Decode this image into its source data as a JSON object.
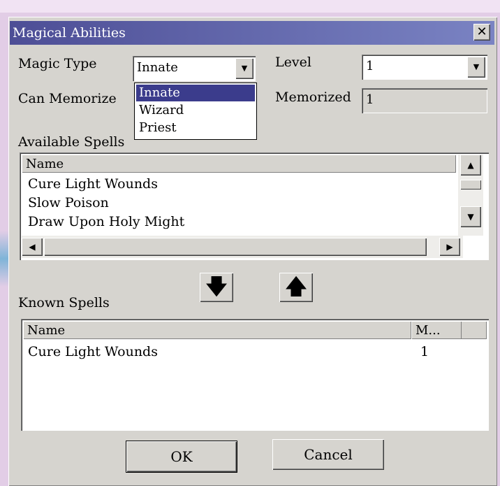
{
  "window": {
    "title": "Magical Abilities",
    "close_glyph": "✕"
  },
  "form": {
    "magic_type_label": "Magic Type",
    "magic_type_value": "Innate",
    "magic_type_options": [
      "Innate",
      "Wizard",
      "Priest"
    ],
    "magic_type_selected_index": 0,
    "level_label": "Level",
    "level_value": "1",
    "can_memorize_label": "Can Memorize",
    "memorized_label": "Memorized",
    "memorized_value": "1"
  },
  "available_spells": {
    "label": "Available Spells",
    "columns": [
      "Name"
    ],
    "rows": [
      "Cure Light Wounds",
      "Slow Poison",
      "Draw Upon Holy Might"
    ]
  },
  "transfer": {
    "down_icon": "down-arrow-icon",
    "down_glyph": "🡇",
    "up_icon": "up-arrow-icon",
    "up_glyph": "🡅"
  },
  "known_spells": {
    "label": "Known Spells",
    "columns": [
      "Name",
      "M..."
    ],
    "rows": [
      {
        "name": "Cure Light Wounds",
        "m": "1"
      }
    ]
  },
  "buttons": {
    "ok_label": "OK",
    "cancel_label": "Cancel"
  },
  "icons": {
    "combo_arrow": "▼",
    "scroll_up": "▲",
    "scroll_down": "▼",
    "scroll_left": "◀",
    "scroll_right": "▶"
  },
  "colors": {
    "titlebar_start": "#4d4e96",
    "titlebar_end": "#7a83c3",
    "dialog_face": "#d6d4cf",
    "selection": "#3b3c8c",
    "page_background": "#e2cde6"
  }
}
